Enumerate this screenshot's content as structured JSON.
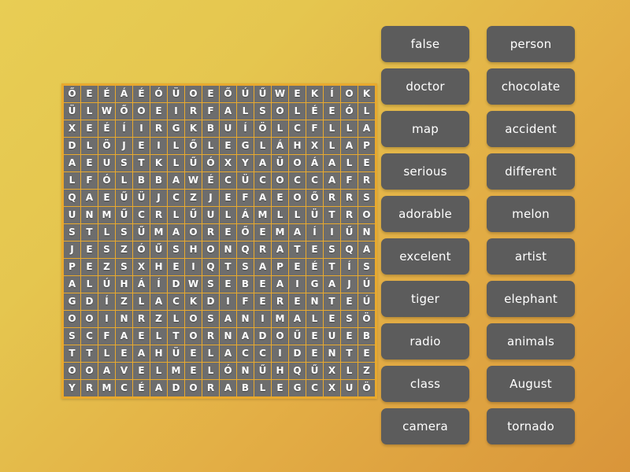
{
  "app": {
    "type": "word-search-puzzle",
    "background_start": "#e8cd54",
    "background_end": "#d9953a"
  },
  "grid": {
    "rows": 17,
    "cols": 18,
    "cell_text_color": "#ffffff",
    "default_cell_color": "#6d6d6d",
    "border_color": "#e8a92e",
    "letters": [
      [
        "Ő",
        "E",
        "É",
        "Á",
        "É",
        "Ó",
        "Ü",
        "O",
        "E",
        "Ő",
        "Ú",
        "Ű",
        "W",
        "E",
        "K",
        "Í",
        "O",
        "K"
      ],
      [
        "Ü",
        "L",
        "W",
        "Ő",
        "O",
        "E",
        "I",
        "R",
        "F",
        "A",
        "L",
        "S",
        "O",
        "L",
        "É",
        "E",
        "Ó",
        "L"
      ],
      [
        "X",
        "E",
        "É",
        "Í",
        "I",
        "R",
        "G",
        "K",
        "B",
        "U",
        "Í",
        "Ö",
        "L",
        "C",
        "F",
        "L",
        "L",
        "A"
      ],
      [
        "D",
        "L",
        "Ö",
        "J",
        "E",
        "I",
        "L",
        "Ő",
        "L",
        "E",
        "G",
        "L",
        "Á",
        "H",
        "X",
        "L",
        "A",
        "P"
      ],
      [
        "A",
        "E",
        "U",
        "S",
        "T",
        "K",
        "L",
        "Ű",
        "Ó",
        "X",
        "Y",
        "A",
        "Ü",
        "O",
        "Á",
        "A",
        "L",
        "E"
      ],
      [
        "L",
        "F",
        "Ó",
        "L",
        "B",
        "B",
        "A",
        "W",
        "É",
        "C",
        "Ü",
        "C",
        "O",
        "C",
        "C",
        "A",
        "F",
        "R"
      ],
      [
        "Q",
        "A",
        "E",
        "Ű",
        "Ü",
        "J",
        "C",
        "Z",
        "J",
        "E",
        "F",
        "A",
        "E",
        "O",
        "Ő",
        "R",
        "R",
        "S"
      ],
      [
        "U",
        "N",
        "M",
        "Ű",
        "C",
        "R",
        "L",
        "Ű",
        "U",
        "L",
        "Á",
        "M",
        "L",
        "L",
        "Ü",
        "T",
        "R",
        "O"
      ],
      [
        "S",
        "T",
        "L",
        "S",
        "Ű",
        "M",
        "A",
        "O",
        "R",
        "E",
        "Ő",
        "E",
        "M",
        "A",
        "Í",
        "I",
        "Ű",
        "N"
      ],
      [
        "J",
        "E",
        "S",
        "Z",
        "Ó",
        "Ű",
        "S",
        "H",
        "O",
        "N",
        "Q",
        "R",
        "A",
        "T",
        "E",
        "S",
        "Q",
        "A"
      ],
      [
        "P",
        "E",
        "Z",
        "S",
        "X",
        "H",
        "E",
        "I",
        "Q",
        "T",
        "S",
        "A",
        "P",
        "E",
        "É",
        "T",
        "Í",
        "S"
      ],
      [
        "A",
        "L",
        "Ú",
        "H",
        "Á",
        "Í",
        "D",
        "W",
        "S",
        "E",
        "B",
        "E",
        "A",
        "I",
        "G",
        "A",
        "J",
        "Ú"
      ],
      [
        "G",
        "D",
        "Í",
        "Z",
        "L",
        "A",
        "C",
        "K",
        "D",
        "I",
        "F",
        "E",
        "R",
        "E",
        "N",
        "T",
        "E",
        "Ú"
      ],
      [
        "O",
        "O",
        "I",
        "N",
        "R",
        "Z",
        "L",
        "O",
        "S",
        "A",
        "N",
        "I",
        "M",
        "A",
        "L",
        "E",
        "S",
        "Ö"
      ],
      [
        "S",
        "C",
        "F",
        "A",
        "E",
        "L",
        "T",
        "O",
        "R",
        "N",
        "A",
        "D",
        "O",
        "Ű",
        "E",
        "U",
        "E",
        "B"
      ],
      [
        "T",
        "T",
        "L",
        "E",
        "A",
        "H",
        "Ü",
        "E",
        "L",
        "A",
        "C",
        "C",
        "I",
        "D",
        "E",
        "N",
        "T",
        "E"
      ],
      [
        "O",
        "O",
        "A",
        "V",
        "E",
        "L",
        "M",
        "E",
        "L",
        "Ó",
        "N",
        "Ű",
        "H",
        "Q",
        "Ű",
        "X",
        "L",
        "Z"
      ],
      [
        "Y",
        "R",
        "M",
        "C",
        "É",
        "A",
        "D",
        "O",
        "R",
        "A",
        "B",
        "L",
        "E",
        "G",
        "C",
        "X",
        "U",
        "Ö"
      ]
    ],
    "highlights": [
      [
        "h-brown",
        "h-purple",
        "h-gray",
        "h-gray",
        "h-gray",
        "h-gray",
        "h-gray",
        "h-orange",
        "h-red",
        "h-gray",
        "h-gray",
        "h-gray",
        "h-gray",
        "h-gray",
        "h-gray",
        "h-gray",
        "h-gray",
        "h-gray"
      ],
      [
        "h-orange",
        "h-purple",
        "h-gray",
        "h-gray",
        "h-gray",
        "h-gray",
        "h-orange",
        "h-red",
        "h-blue",
        "h-blue",
        "h-blue",
        "h-blue",
        "h-blue",
        "h-orange",
        "h-gray",
        "h-blue",
        "h-gray",
        "h-red"
      ],
      [
        "h-orange",
        "h-purple",
        "h-gray",
        "h-gray",
        "h-gray",
        "h-orange",
        "h-red",
        "h-gray",
        "h-gray",
        "h-gray",
        "h-gray",
        "h-gray",
        "h-gray",
        "h-gray",
        "h-blue",
        "h-blue",
        "h-gray",
        "h-red"
      ],
      [
        "h-orange",
        "h-purple",
        "h-gray",
        "h-gray",
        "h-gray",
        "h-red",
        "h-gray",
        "h-gray",
        "h-gray",
        "h-green",
        "h-gray",
        "h-navy",
        "h-gray",
        "h-gray",
        "h-gray",
        "h-blue",
        "h-gray",
        "h-red"
      ],
      [
        "h-gray",
        "h-purple",
        "h-gray",
        "h-orange",
        "h-red",
        "h-gray",
        "h-purple",
        "h-gray",
        "h-gray",
        "h-green",
        "h-gray",
        "h-navy",
        "h-gray",
        "h-gray",
        "h-gray",
        "h-blue",
        "h-gray",
        "h-red"
      ],
      [
        "h-orange",
        "h-purple",
        "h-gray",
        "h-red",
        "h-gray",
        "h-gray",
        "h-purple",
        "h-gray",
        "h-gray",
        "h-green",
        "h-gray",
        "h-navy",
        "h-gray",
        "h-orange",
        "h-gray",
        "h-blue",
        "h-gray",
        "h-red"
      ],
      [
        "h-gray",
        "h-purple",
        "h-red",
        "h-gray",
        "h-gray",
        "h-gray",
        "h-purple",
        "h-gray",
        "h-gray",
        "h-green",
        "h-gray",
        "h-navy",
        "h-navy",
        "h-gray",
        "h-orange",
        "h-blue",
        "h-gray",
        "h-red"
      ],
      [
        "h-gray",
        "h-purple",
        "h-gray",
        "h-gray",
        "h-gray",
        "h-gray",
        "h-purple",
        "h-gray",
        "h-gray",
        "h-green",
        "h-navy",
        "h-navy",
        "h-navy",
        "h-orange",
        "h-gray",
        "h-blue",
        "h-gray",
        "h-red"
      ],
      [
        "h-gray",
        "h-purple",
        "h-gray",
        "h-gray",
        "h-gray",
        "h-gray",
        "h-purple",
        "h-gray",
        "h-gray",
        "h-green",
        "h-gray",
        "h-navy",
        "h-navy",
        "h-orange",
        "h-blue",
        "h-blue",
        "h-gray",
        "h-red"
      ],
      [
        "h-gray",
        "h-purple",
        "h-gray",
        "h-gray",
        "h-gray",
        "h-gray",
        "h-purple",
        "h-gray",
        "h-brown",
        "h-green",
        "h-gray",
        "h-navy",
        "h-navy",
        "h-orange",
        "h-gray",
        "h-blue",
        "h-gray",
        "h-red"
      ],
      [
        "h-gray",
        "h-brown",
        "h-gray",
        "h-gray",
        "h-gray",
        "h-gray",
        "h-purple",
        "h-brown",
        "h-gray",
        "h-green",
        "h-gray",
        "h-navy",
        "h-orange",
        "h-orange",
        "h-gray",
        "h-blue",
        "h-gray",
        "h-gray"
      ],
      [
        "h-brown",
        "h-brown",
        "h-gray",
        "h-gray",
        "h-gray",
        "h-gray",
        "h-brown",
        "h-gray",
        "h-gray",
        "h-green",
        "h-gray",
        "h-navy",
        "h-navy",
        "h-gray",
        "h-gray",
        "h-blue",
        "h-gray",
        "h-gray"
      ],
      [
        "h-brown",
        "h-brown",
        "h-gray",
        "h-gray",
        "h-gray",
        "h-brown",
        "h-gray",
        "h-gray",
        "h-blue",
        "h-blue",
        "h-blue",
        "h-blue",
        "h-blue",
        "h-blue",
        "h-blue",
        "h-blue",
        "h-blue",
        "h-gray"
      ],
      [
        "h-brown",
        "h-brown",
        "h-gray",
        "h-gray",
        "h-brown",
        "h-gray",
        "h-purple",
        "h-purple",
        "h-purple",
        "h-purple",
        "h-purple",
        "h-purple",
        "h-purple",
        "h-purple",
        "h-purple",
        "h-purple",
        "h-purple",
        "h-gray"
      ],
      [
        "h-brown",
        "h-brown",
        "h-gray",
        "h-brown",
        "h-green",
        "h-green",
        "h-green",
        "h-green",
        "h-green",
        "h-green",
        "h-green",
        "h-green",
        "h-green",
        "h-gray",
        "h-gray",
        "h-gray",
        "h-gray",
        "h-gray"
      ],
      [
        "h-brown",
        "h-brown",
        "h-brown",
        "h-gray",
        "h-gray",
        "h-gray",
        "h-orange",
        "h-red",
        "h-red",
        "h-red",
        "h-red",
        "h-red",
        "h-red",
        "h-red",
        "h-red",
        "h-red",
        "h-red",
        "h-red"
      ],
      [
        "h-brown",
        "h-brown",
        "h-gray",
        "h-gray",
        "h-green",
        "h-green",
        "h-green",
        "h-green",
        "h-green",
        "h-green",
        "h-green",
        "h-gray",
        "h-gray",
        "h-gray",
        "h-gray",
        "h-gray",
        "h-gray",
        "h-gray"
      ],
      [
        "h-brown",
        "h-brown",
        "h-gray",
        "h-gray",
        "h-gray",
        "h-navy",
        "h-navy",
        "h-navy",
        "h-navy",
        "h-navy",
        "h-navy",
        "h-navy",
        "h-navy",
        "h-gray",
        "h-gray",
        "h-gray",
        "h-gray",
        "h-gray"
      ]
    ]
  },
  "wordlist": {
    "button_color": "#5c5c5c",
    "text_color": "#ffffff",
    "words": [
      "false",
      "person",
      "doctor",
      "chocolate",
      "map",
      "accident",
      "serious",
      "different",
      "adorable",
      "melon",
      "excelent",
      "artist",
      "tiger",
      "elephant",
      "radio",
      "animals",
      "class",
      "August",
      "camera",
      "tornado"
    ]
  }
}
